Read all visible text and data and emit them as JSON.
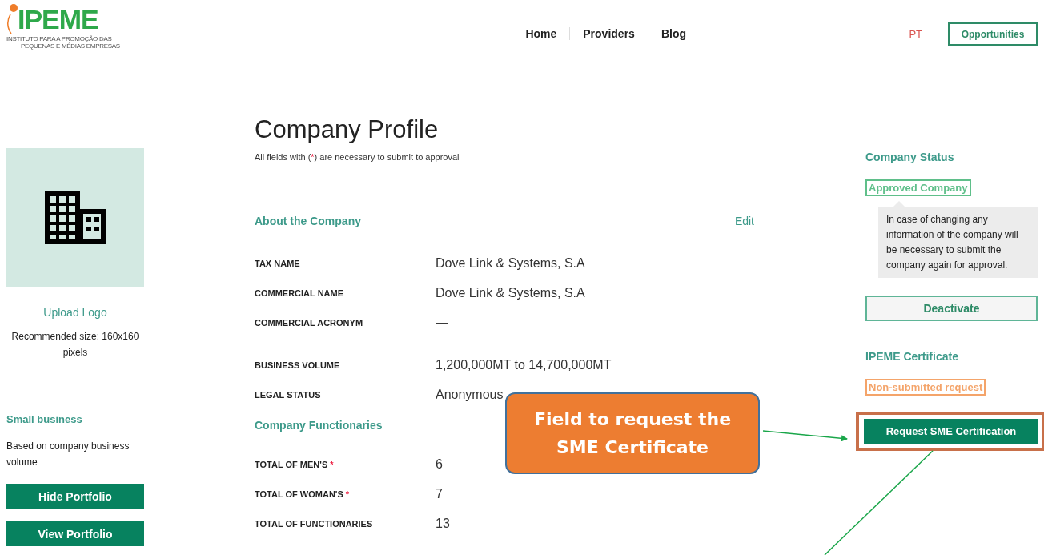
{
  "header": {
    "logo": {
      "name": "IPEME",
      "tagline": [
        "INSTITUTO PARA A PROMOÇÃO DAS",
        "PEQUENAS E MÉDIAS EMPRESAS"
      ]
    },
    "nav": [
      "Home",
      "Providers",
      "Blog"
    ],
    "language": "PT",
    "action": "Opportunities"
  },
  "sidebar": {
    "upload_link": "Upload Logo",
    "hint": "Recommended size: 160x160 pixels",
    "category": "Small business",
    "category_note": "Based on company business volume",
    "buttons": [
      "Hide Portfolio",
      "View Portfolio"
    ]
  },
  "profile": {
    "title": "Company Profile",
    "note": [
      "All fields with (",
      ") are necessary to submit to approval"
    ],
    "required_mark": "*",
    "sections": [
      {
        "title": "About the Company",
        "action": "Edit",
        "fields": [
          {
            "label": "TAX NAME",
            "value": "Dove Link & Systems, S.A",
            "required": false
          },
          {
            "label": "COMMERCIAL NAME",
            "value": "Dove Link & Systems, S.A",
            "required": false
          },
          {
            "label": "COMMERCIAL ACRONYM",
            "value": "—",
            "required": false
          },
          {
            "label": "BUSINESS VOLUME",
            "value": "1,200,000MT to 14,700,000MT",
            "required": false
          },
          {
            "label": "LEGAL STATUS",
            "value": "Anonymous",
            "required": false
          }
        ]
      },
      {
        "title": "Company Functionaries",
        "fields": [
          {
            "label": "TOTAL OF MEN'S",
            "value": "6",
            "required": true
          },
          {
            "label": "TOTAL OF WOMAN'S",
            "value": "7",
            "required": true
          },
          {
            "label": "TOTAL OF FUNCTIONARIES",
            "value": "13",
            "required": false
          }
        ]
      }
    ]
  },
  "status_panel": {
    "title": "Company Status",
    "badge": {
      "text": "Approved Company",
      "color": "#5fbf8a"
    },
    "info": "In case of changing any information of the company will be necessary to submit the company again for approval.",
    "button": "Deactivate"
  },
  "certificate_panel": {
    "title": "IPEME Certificate",
    "badge": {
      "text": "Non-submitted request",
      "color": "#f4a46a"
    },
    "button": "Request SME Certification"
  },
  "annotation": {
    "text": "Field to request the SME Certificate"
  }
}
